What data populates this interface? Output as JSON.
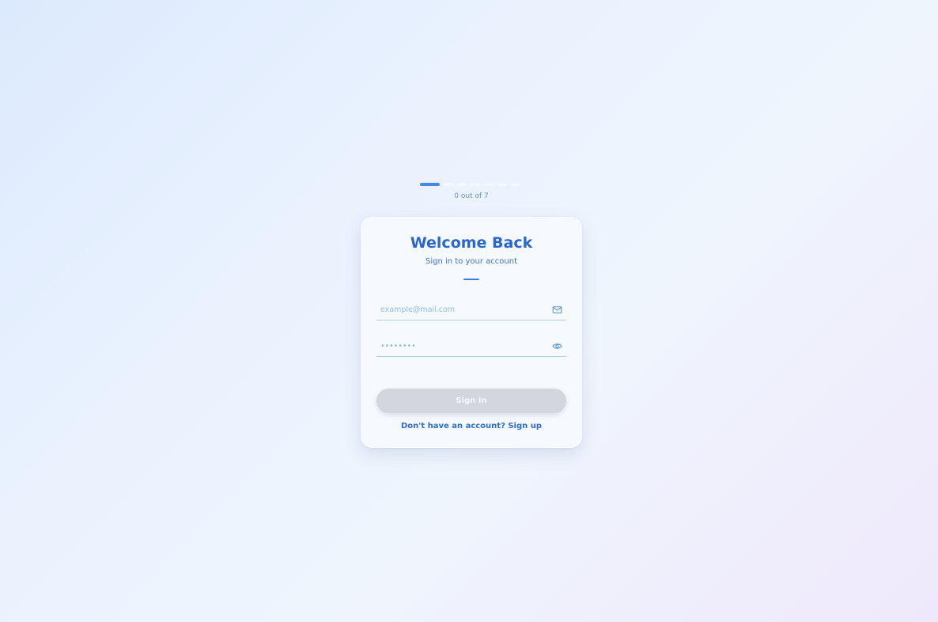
{
  "progress": {
    "label": "0 out of 7",
    "total_steps": 7,
    "current_step": 0
  },
  "login": {
    "title": "Welcome Back",
    "subtitle": "Sign in to your account",
    "email_placeholder": "example@mail.com",
    "email_value": "",
    "password_placeholder": "••••••••",
    "password_value": "",
    "submit_label": "Sign In",
    "signup_link": "Don't have an account? Sign up"
  },
  "icons": {
    "email": "mail-icon",
    "password": "eye-icon"
  },
  "colors": {
    "accent": "#2a66cf",
    "progress_active": "#4a86e4",
    "button_disabled": "#d3d6dc",
    "field_underline": "#a9d3ec"
  }
}
